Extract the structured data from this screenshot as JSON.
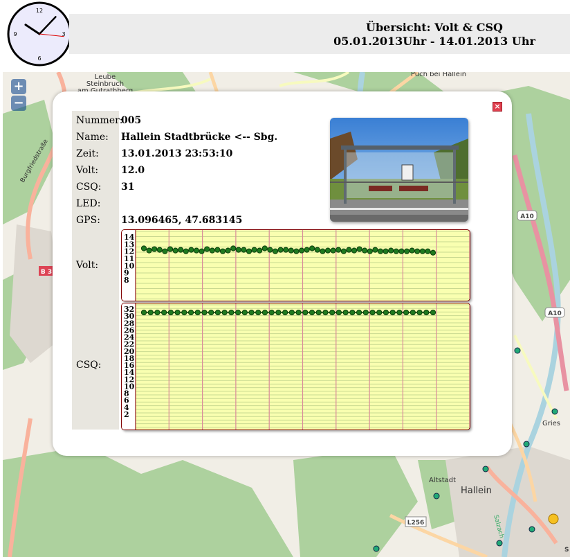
{
  "header": {
    "title": "Übersicht: Volt & CSQ",
    "date_range": "05.01.2013Uhr - 14.01.2013 Uhr"
  },
  "clock": {
    "numbers": [
      "12",
      "3",
      "6",
      "9"
    ],
    "hour": 10,
    "minute": 7,
    "second": 16
  },
  "map": {
    "zoom_in_label": "+",
    "zoom_out_label": "−",
    "place_labels": [
      "Leube",
      "Steinbruch",
      "am Gutrathberg",
      "Puch bei Hallein",
      "Gries",
      "Altstadt",
      "Hallein",
      "Burgfriedstraße",
      "Salzach"
    ],
    "road_labels": [
      "A10",
      "A10",
      "B 3",
      "L256",
      "S"
    ],
    "colors": {
      "background": "#f1eee6",
      "forest": "#add19e",
      "motorway": "#e892a2",
      "trunk": "#f9b29c",
      "primary": "#fcd6a4",
      "secondary": "#f7fabf",
      "river": "#aad3df",
      "urban": "#ddd8d0"
    }
  },
  "popup": {
    "close_icon": "close-icon",
    "fields": [
      {
        "label": "Nummer:",
        "value": "005"
      },
      {
        "label": "Name:",
        "value": "Hallein Stadtbrücke <-- Sbg."
      },
      {
        "label": "Zeit:",
        "value": "13.01.2013 23:53:10"
      },
      {
        "label": "Volt:",
        "value": "12.0"
      },
      {
        "label": "CSQ:",
        "value": "31"
      },
      {
        "label": "LED:",
        "value": ""
      },
      {
        "label": "GPS:",
        "value": "13.096465, 47.683145"
      }
    ],
    "volt_chart_label": "Volt:",
    "csq_chart_label": "CSQ:",
    "photo_icon": "bus-shelter-photo"
  },
  "chart_data": [
    {
      "type": "line",
      "title": "",
      "xlabel": "",
      "ylabel": "Volt",
      "ylim": [
        8,
        14
      ],
      "yticks": [
        "14",
        "13",
        "12",
        "11",
        "10",
        "9",
        "8"
      ],
      "grid": true,
      "series": [
        {
          "values": [
            12.4,
            12.1,
            12.3,
            12.2,
            12.0,
            12.3,
            12.1,
            12.2,
            12.0,
            12.2,
            12.1,
            12.0,
            12.3,
            12.1,
            12.2,
            12.0,
            12.1,
            12.4,
            12.2,
            12.2,
            12.0,
            12.2,
            12.1,
            12.4,
            12.2,
            12.0,
            12.2,
            12.2,
            12.1,
            12.0,
            12.1,
            12.2,
            12.4,
            12.2,
            12.0,
            12.1,
            12.1,
            12.2,
            12.0,
            12.2,
            12.1,
            12.3,
            12.1,
            12.0,
            12.2,
            12.0,
            12.0,
            12.1,
            12.0,
            12.0,
            12.0,
            12.1,
            12.0,
            12.0,
            12.0,
            11.8
          ],
          "color": "#1f7a1f"
        }
      ]
    },
    {
      "type": "line",
      "title": "",
      "xlabel": "",
      "ylabel": "CSQ",
      "ylim": [
        0,
        32
      ],
      "yticks": [
        "32",
        "30",
        "28",
        "26",
        "24",
        "22",
        "20",
        "18",
        "16",
        "14",
        "12",
        "10",
        "8",
        "6",
        "4",
        "2"
      ],
      "grid": true,
      "series": [
        {
          "values": [
            31,
            31,
            31,
            31,
            31,
            31,
            31,
            31,
            31,
            31,
            31,
            31,
            31,
            31,
            31,
            31,
            31,
            31,
            31,
            31,
            31,
            31,
            31,
            31,
            31,
            31,
            31,
            31,
            31,
            31,
            31,
            31,
            31,
            31,
            31,
            31,
            31,
            31,
            31,
            31,
            31,
            31,
            31,
            31
          ],
          "color": "#1f7a1f"
        }
      ]
    }
  ]
}
